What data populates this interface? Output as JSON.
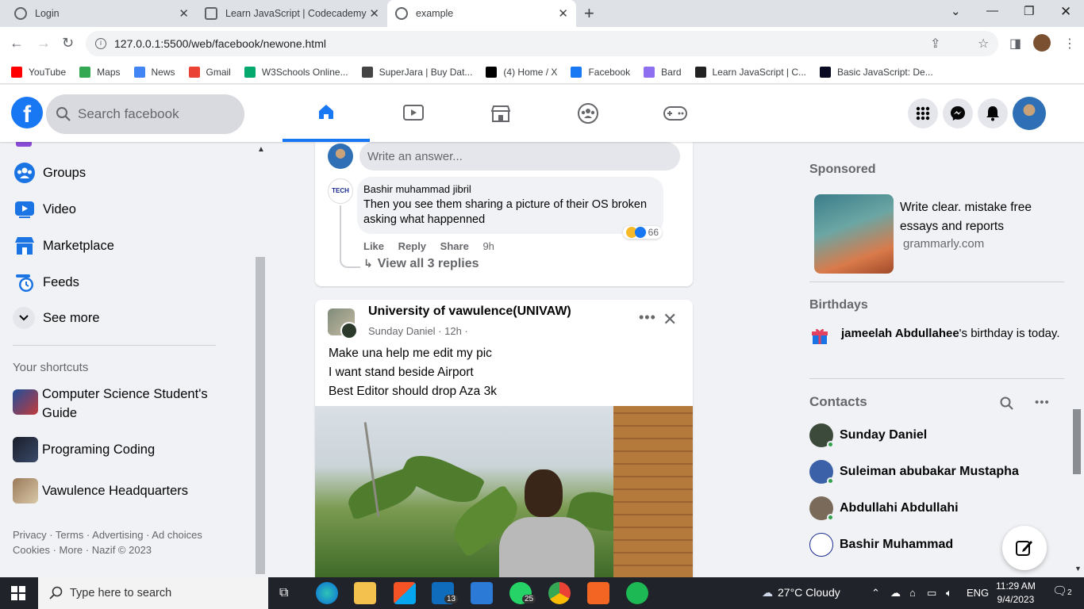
{
  "browser": {
    "tabs": [
      {
        "label": "Login"
      },
      {
        "label": "Learn JavaScript | Codecademy"
      },
      {
        "label": "example"
      }
    ],
    "url": "127.0.0.1:5500/web/facebook/newone.html",
    "bookmarks": [
      {
        "label": "YouTube",
        "color": "#ff0000"
      },
      {
        "label": "Maps",
        "color": "#34a853"
      },
      {
        "label": "News",
        "color": "#4285f4"
      },
      {
        "label": "Gmail",
        "color": "#ea4335"
      },
      {
        "label": "W3Schools Online...",
        "color": "#04aa6d"
      },
      {
        "label": "SuperJara | Buy Dat...",
        "color": "#444444"
      },
      {
        "label": "(4) Home / X",
        "color": "#000000"
      },
      {
        "label": "Facebook",
        "color": "#1877f2"
      },
      {
        "label": "Bard",
        "color": "#8e6ff0"
      },
      {
        "label": "Learn JavaScript | C...",
        "color": "#222222"
      },
      {
        "label": "Basic JavaScript: De...",
        "color": "#0a0a23"
      }
    ]
  },
  "header": {
    "search_placeholder": "Search facebook",
    "nav_icons": [
      "home-icon",
      "video-icon",
      "marketplace-icon",
      "groups-icon",
      "gaming-icon"
    ],
    "brand_color": "#1877f2"
  },
  "sidebar": {
    "items": [
      {
        "label": "Groups"
      },
      {
        "label": "Video"
      },
      {
        "label": "Marketplace"
      },
      {
        "label": "Feeds"
      },
      {
        "label": "See more"
      }
    ],
    "shortcuts_title": "Your shortcuts",
    "shortcuts": [
      {
        "label": "Computer Science Student's Guide"
      },
      {
        "label": "Programing Coding"
      },
      {
        "label": "Vawulence Headquarters"
      }
    ],
    "footer_line1": "Privacy · Terms · Advertising · Ad choices",
    "footer_line2": "Cookies · More · Nazif © 2023"
  },
  "feed": {
    "answer_placeholder": "Write an answer...",
    "comment": {
      "author": "Bashir muhammad jibril",
      "text": "Then you see them sharing a picture of their OS broken asking what happenned",
      "reaction_count": "66",
      "actions": [
        "Like",
        "Reply",
        "Share"
      ],
      "time": "9h",
      "view_replies": "View all 3 replies",
      "avatar_text": "TECH"
    },
    "post": {
      "group": "University of vawulence(UNIVAW)",
      "meta": "Sunday Daniel · 12h ·",
      "lines": [
        "Make una help me edit my pic",
        "I want stand beside Airport",
        "Best Editor should drop Aza 3k"
      ]
    }
  },
  "rightbar": {
    "sponsored_title": "Sponsored",
    "ad_text": "Write clear. mistake free essays and reports",
    "ad_domain": "grammarly.com",
    "birthdays_title": "Birthdays",
    "birthday_name": "jameelah Abdullahee",
    "birthday_rest": "'s birthday is today.",
    "contacts_title": "Contacts",
    "contacts": [
      {
        "name": "Sunday Daniel",
        "color": "#3b4a3a"
      },
      {
        "name": "Suleiman abubakar Mustapha",
        "color": "#3b62a8"
      },
      {
        "name": "Abdullahi Abdullahi",
        "color": "#7a6a5a"
      },
      {
        "name": "Bashir Muhammad",
        "color": "#ffffff"
      }
    ]
  },
  "taskbar": {
    "search_placeholder": "Type here to search",
    "badges": {
      "mail": "13",
      "whatsapp": "25"
    },
    "weather": "27°C  Cloudy",
    "lang": "ENG",
    "time": "11:29 AM",
    "date": "9/4/2023",
    "notifications": "2"
  }
}
